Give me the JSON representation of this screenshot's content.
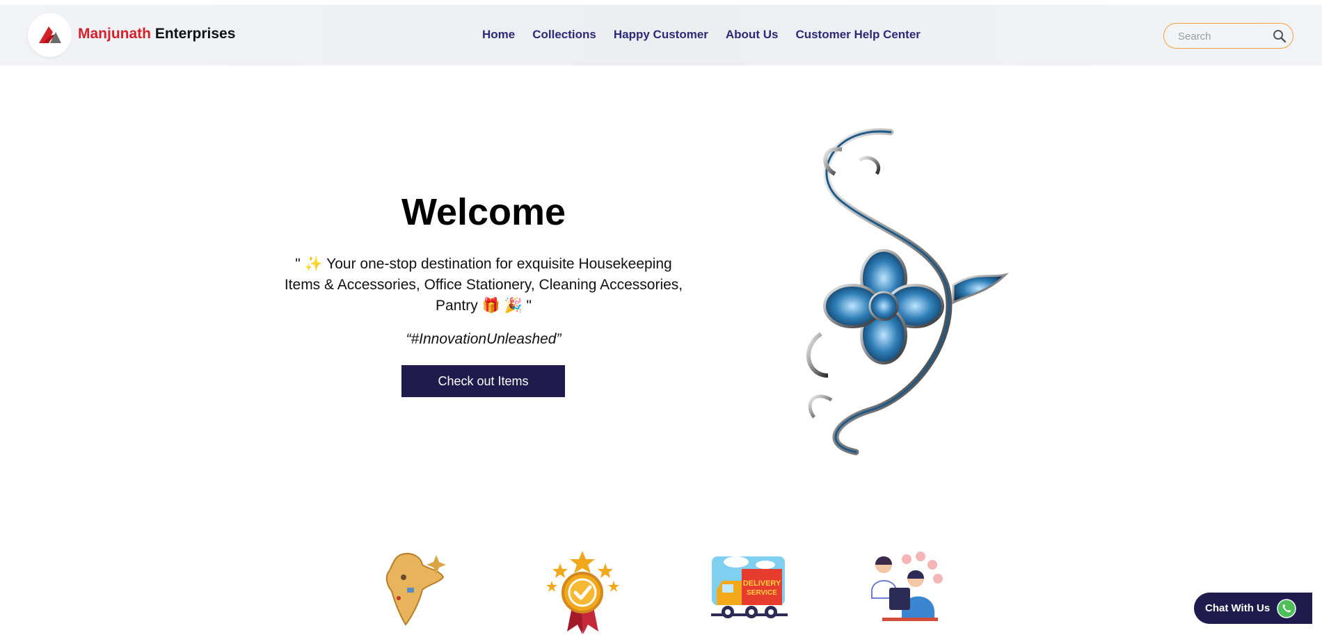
{
  "brand": {
    "name_part1": "Manjunath",
    "name_part2": "Enterprises",
    "accent_color": "#d32029"
  },
  "nav": {
    "items": [
      {
        "label": "Home"
      },
      {
        "label": "Collections"
      },
      {
        "label": "Happy Customer"
      },
      {
        "label": "About Us"
      },
      {
        "label": "Customer Help Center"
      }
    ],
    "link_color": "#2c2a78"
  },
  "search": {
    "placeholder": "Search",
    "icon": "search-icon"
  },
  "hero": {
    "title": "Welcome",
    "description": "\" ✨ Your one-stop destination for exquisite Housekeeping Items & Accessories, Office Stationery, Cleaning Accessories, Pantry 🎁 🎉 \"",
    "tagline": "“#InnovationUnleashed”",
    "cta_label": "Check out Items",
    "cta_color": "#1f1b4d"
  },
  "features": [
    {
      "icon": "india-map-icon"
    },
    {
      "icon": "award-badge-icon"
    },
    {
      "icon": "delivery-truck-icon"
    },
    {
      "icon": "customer-support-icon"
    }
  ],
  "chat": {
    "label": "Chat With Us",
    "icon": "whatsapp-icon"
  }
}
